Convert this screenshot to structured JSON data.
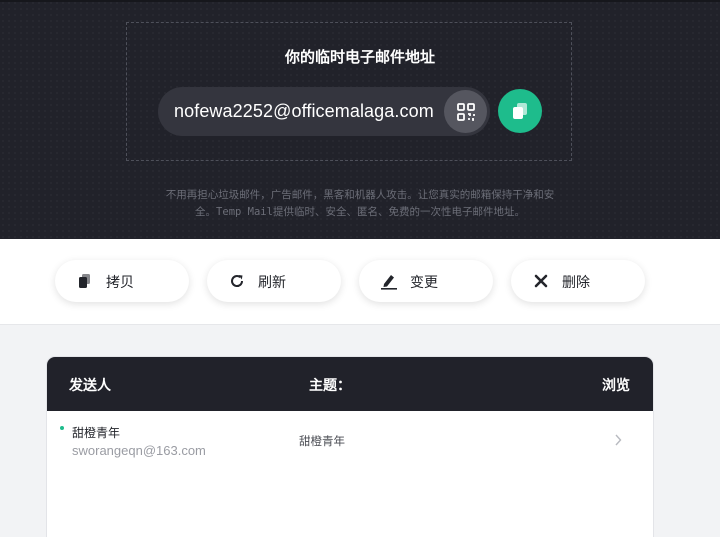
{
  "hero": {
    "title": "你的临时电子邮件地址",
    "email": "nofewa2252@officemalaga.com",
    "description_line1": "不用再担心垃圾邮件，广告邮件，黑客和机器人攻击。让您真实的邮箱保持干净和安",
    "description_line2": "全。Temp Mail提供临时、安全、匿名、免费的一次性电子邮件地址。",
    "qr_icon": "qr-code-icon",
    "copy_icon": "copy-icon"
  },
  "actions": [
    {
      "label": "拷贝",
      "icon": "copy-icon"
    },
    {
      "label": "刷新",
      "icon": "refresh-icon"
    },
    {
      "label": "变更",
      "icon": "edit-icon"
    },
    {
      "label": "删除",
      "icon": "close-icon"
    }
  ],
  "inbox": {
    "columns": {
      "sender": "发送人",
      "subject": "主题：",
      "view": "浏览"
    },
    "messages": [
      {
        "sender_name": "甜橙青年",
        "sender_email": "sworangeqn@163.com",
        "subject": "甜橙青年",
        "unread": true
      }
    ]
  },
  "colors": {
    "accent": "#1ebc8c",
    "dark": "#21222a"
  }
}
